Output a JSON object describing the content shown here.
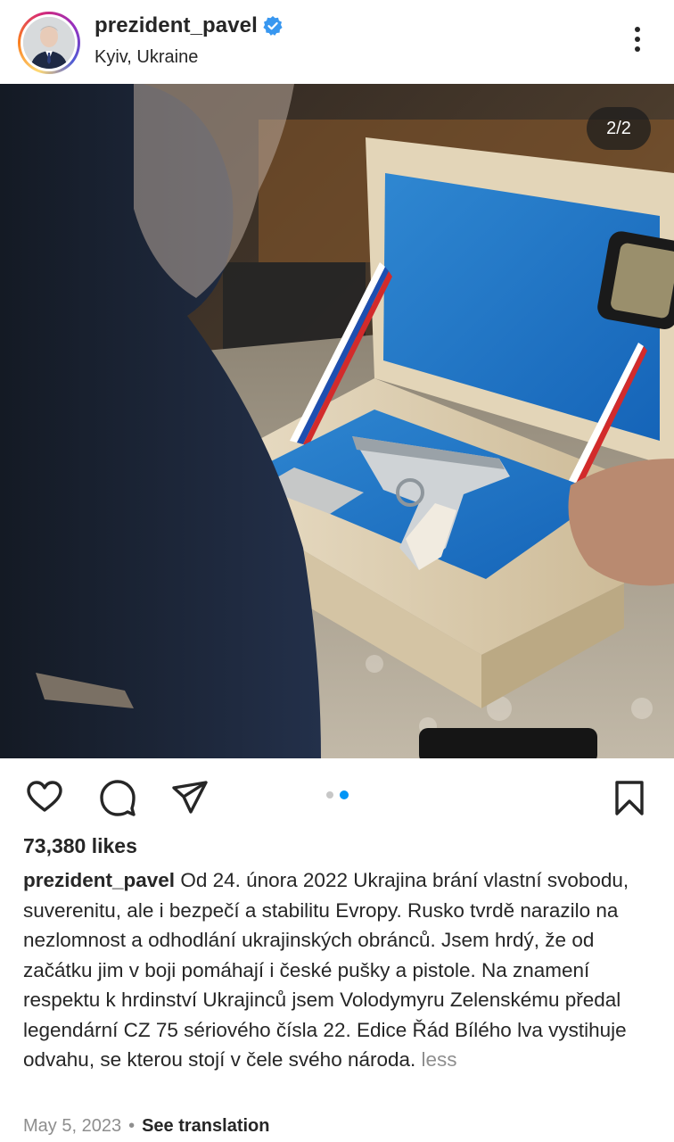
{
  "post": {
    "username": "prezident_pavel",
    "location": "Kyiv, Ukraine",
    "image_counter": "2/2",
    "likes": "73,380 likes",
    "caption_user": "prezident_pavel",
    "caption_text": "Od 24. února 2022 Ukrajina brání vlastní svobodu, suverenitu, ale i bezpečí a stabilitu Evropy. Rusko tvrdě narazilo na nezlomnost a odhodlání ukrajinských obránců. Jsem hrdý, že od začátku jim v boji pomáhají i české pušky a pistole. Na znamení respektu k hrdinství Ukrajinců jsem Volodymyru Zelenskému předal legendární CZ 75 sériového čísla 22. Edice Řád Bílého lva vystihuje odvahu, se kterou stojí v čele svého národa.",
    "less_label": "less",
    "date": "May 5, 2023",
    "separator": "•",
    "translate_label": "See translation",
    "carousel": {
      "count": 2,
      "active": 2
    }
  },
  "icons": {
    "verified": "verified-badge-icon",
    "more": "more-options-icon",
    "like": "heart-icon",
    "comment": "comment-icon",
    "share": "share-icon",
    "save": "bookmark-icon"
  },
  "colors": {
    "verified_blue": "#3897f0",
    "active_dot": "#0095f6",
    "inactive_dot": "#c7c7c7",
    "text": "#262626",
    "secondary_text": "#8e8e8e"
  }
}
